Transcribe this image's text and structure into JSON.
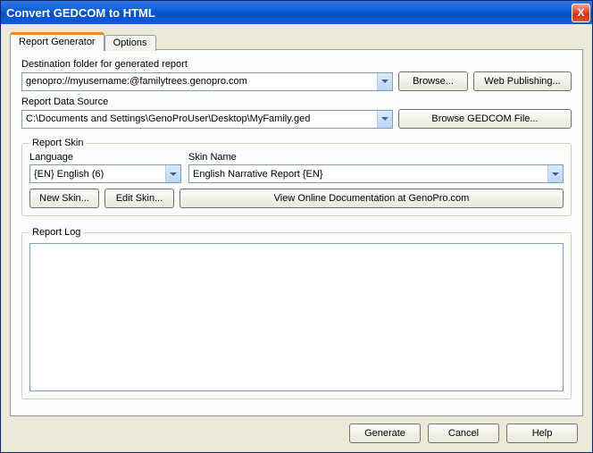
{
  "window": {
    "title": "Convert GEDCOM to HTML",
    "close_glyph": "X"
  },
  "tabs": {
    "report_generator": "Report Generator",
    "options": "Options"
  },
  "dest": {
    "label": "Destination folder for generated report",
    "value": "genopro://myusername:@familytrees.genopro.com",
    "browse": "Browse...",
    "web_publishing": "Web Publishing..."
  },
  "source": {
    "label": "Report Data Source",
    "value": "C:\\Documents and Settings\\GenoProUser\\Desktop\\MyFamily.ged",
    "browse_gedcom": "Browse GEDCOM File..."
  },
  "skin": {
    "legend": "Report Skin",
    "language_label": "Language",
    "language_value": "{EN}  English  (6)",
    "name_label": "Skin Name",
    "name_value": "English Narrative Report  {EN}",
    "new_skin": "New Skin...",
    "edit_skin": "Edit Skin...",
    "online_doc": "View Online Documentation at GenoPro.com"
  },
  "log": {
    "legend": "Report Log"
  },
  "buttons": {
    "generate": "Generate",
    "cancel": "Cancel",
    "help": "Help"
  }
}
